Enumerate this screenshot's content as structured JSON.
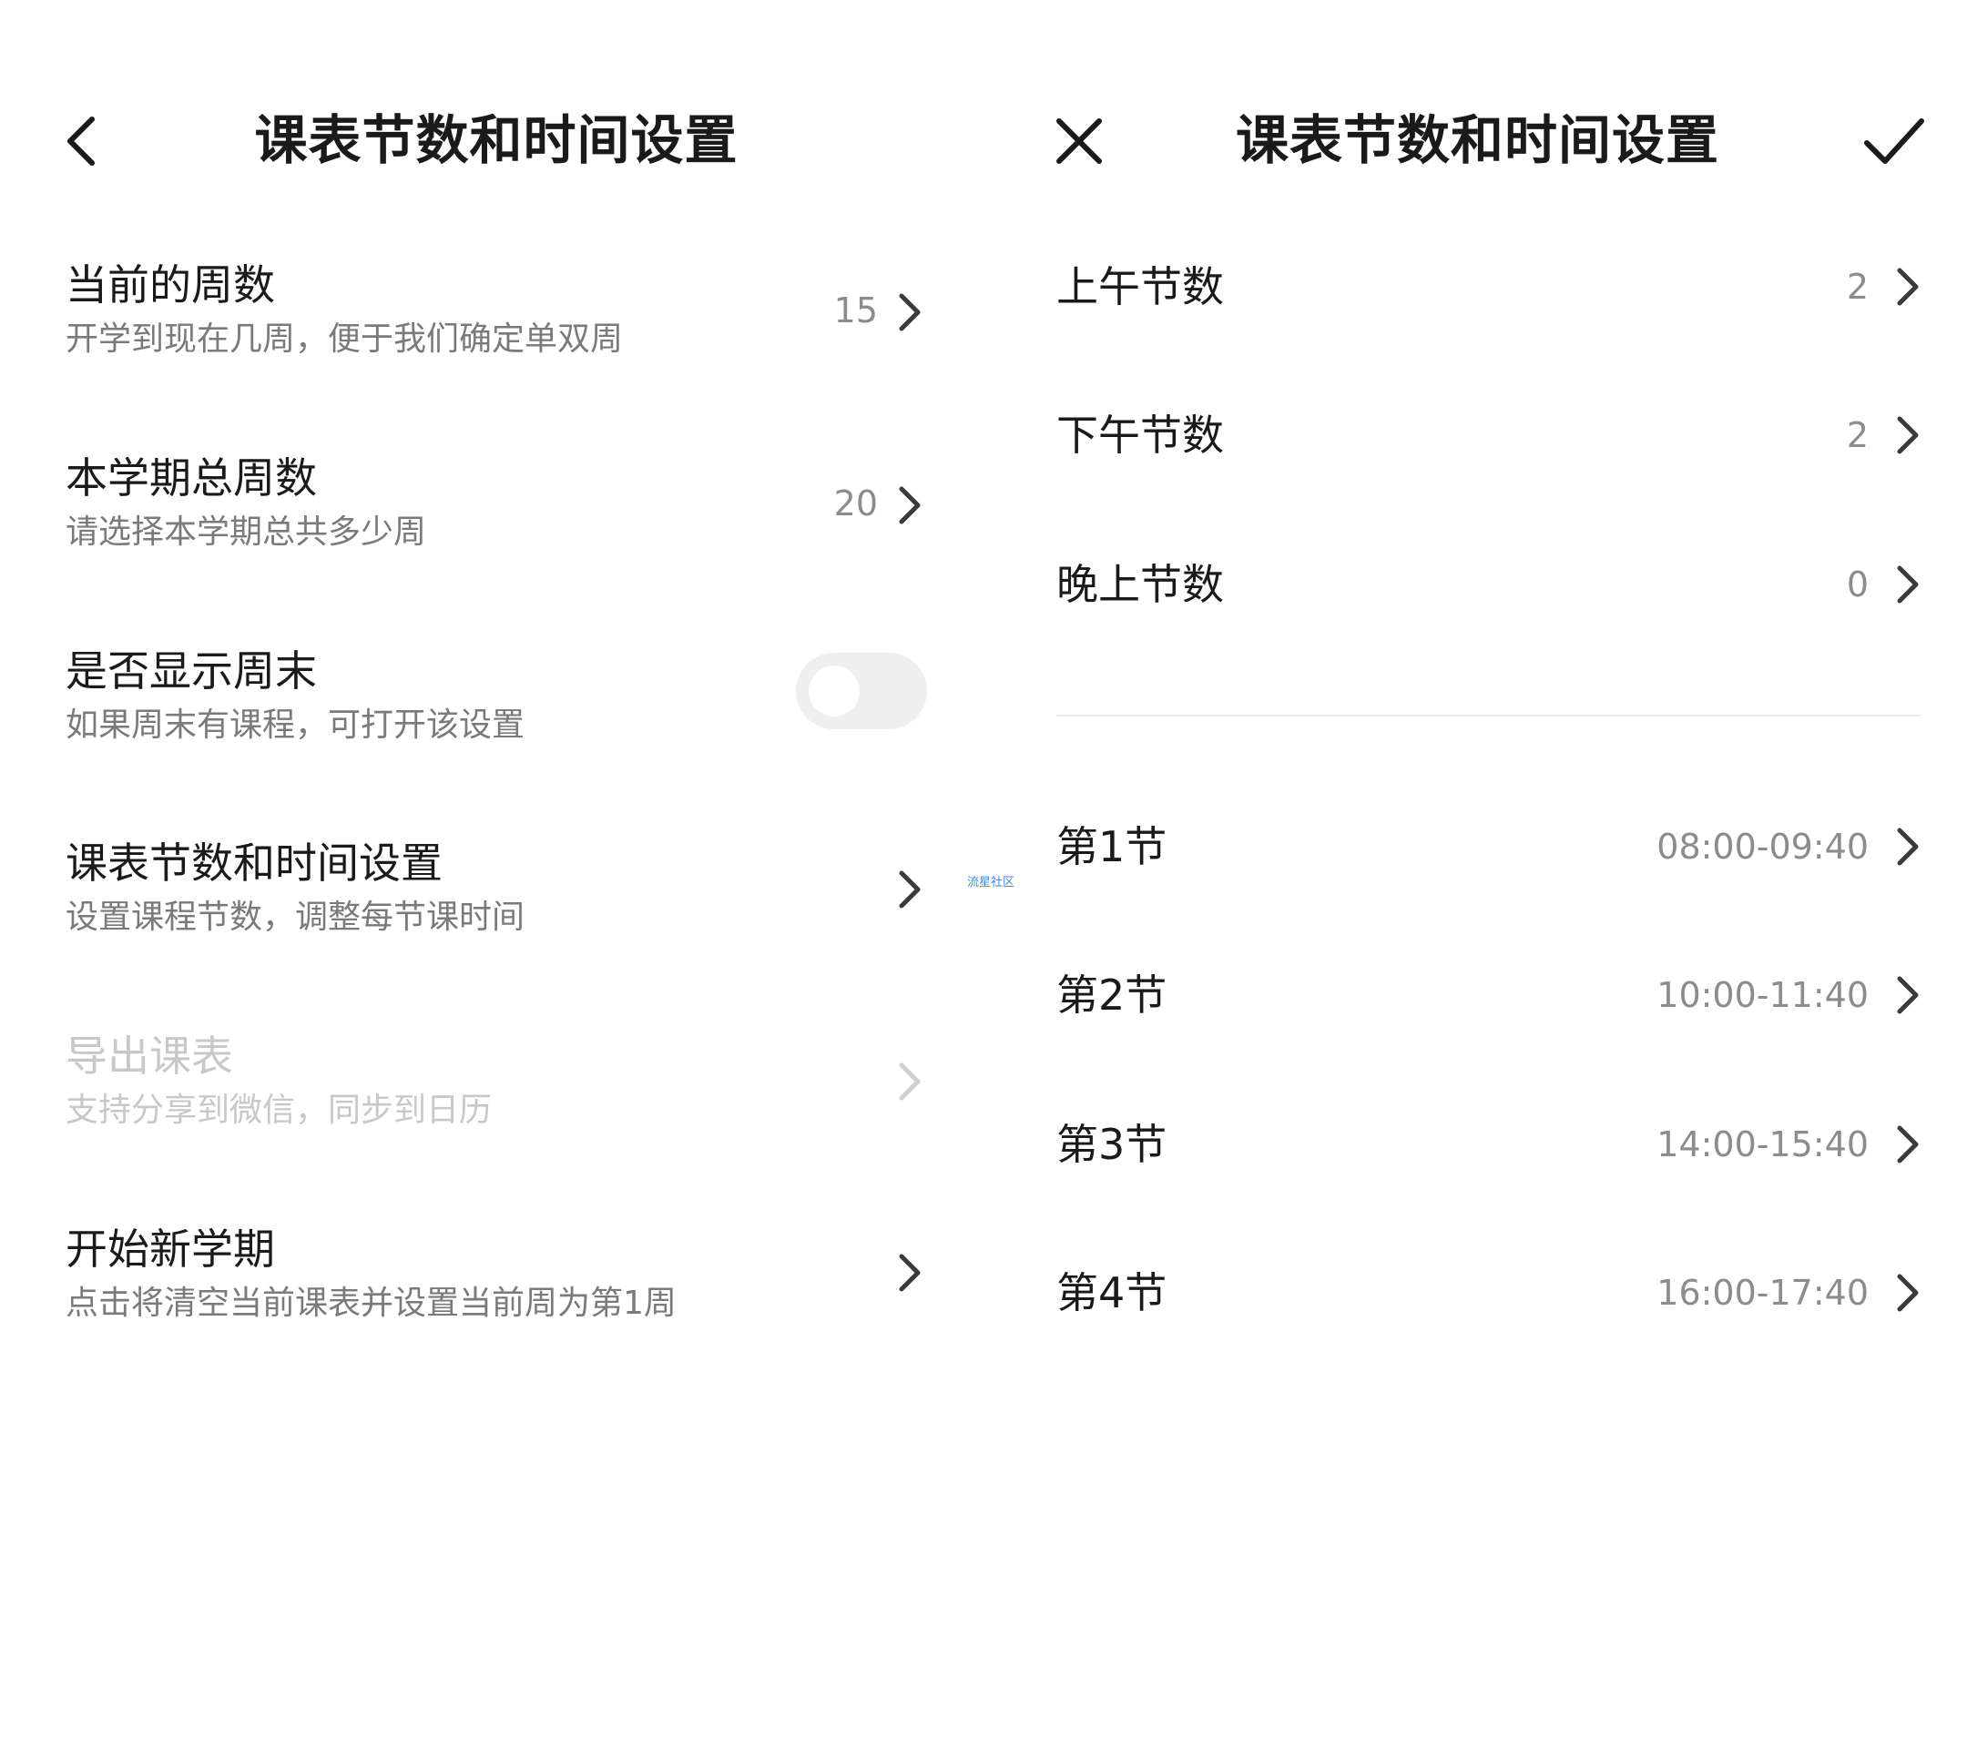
{
  "left": {
    "title": "课表节数和时间设置",
    "items": [
      {
        "label": "当前的周数",
        "desc": "开学到现在几周，便于我们确定单双周",
        "value": "15"
      },
      {
        "label": "本学期总周数",
        "desc": "请选择本学期总共多少周",
        "value": "20"
      },
      {
        "label": "是否显示周末",
        "desc": "如果周末有课程，可打开该设置",
        "toggle_on": false
      },
      {
        "label": "课表节数和时间设置",
        "desc": "设置课程节数，调整每节课时间"
      },
      {
        "label": "导出课表",
        "desc": "支持分享到微信，同步到日历",
        "disabled": true
      },
      {
        "label": "开始新学期",
        "desc": "点击将清空当前课表并设置当前周为第1周"
      }
    ]
  },
  "watermark": "流星社区",
  "right": {
    "title": "课表节数和时间设置",
    "counts": [
      {
        "label": "上午节数",
        "value": "2"
      },
      {
        "label": "下午节数",
        "value": "2"
      },
      {
        "label": "晚上节数",
        "value": "0"
      }
    ],
    "periods": [
      {
        "label": "第1节",
        "time": "08:00-09:40"
      },
      {
        "label": "第2节",
        "time": "10:00-11:40"
      },
      {
        "label": "第3节",
        "time": "14:00-15:40"
      },
      {
        "label": "第4节",
        "time": "16:00-17:40"
      }
    ]
  },
  "colors": {
    "text_primary": "#1a1a1a",
    "text_secondary": "#7a7a7a",
    "value_gray": "#8c8c8c",
    "disabled": "#c8c8c8",
    "toggle_off": "#efefef",
    "watermark": "#3a8ee6"
  },
  "icons": [
    "back-icon",
    "close-icon",
    "check-icon",
    "chevron-right-icon"
  ]
}
